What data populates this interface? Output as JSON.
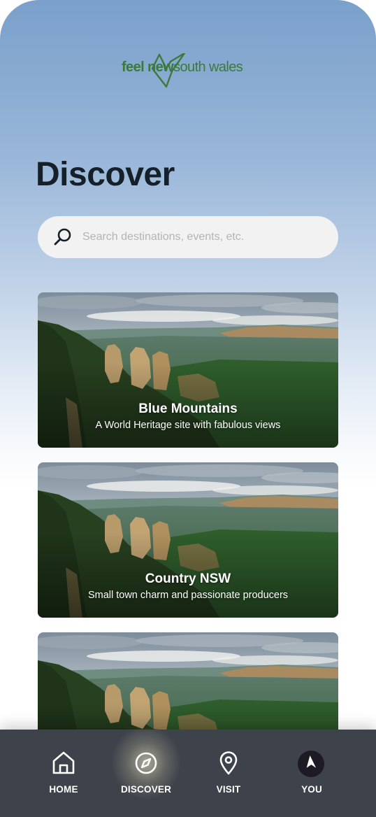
{
  "brand": {
    "logo_bold": "feel new",
    "logo_regular": "south wales",
    "logo_color": "#3b7a3a"
  },
  "page": {
    "title": "Discover"
  },
  "search": {
    "placeholder": "Search destinations, events, etc.",
    "value": "",
    "icon": "search-icon"
  },
  "cards": [
    {
      "title": "Blue Mountains",
      "subtitle": "A World Heritage site with fabulous views"
    },
    {
      "title": "Country NSW",
      "subtitle": "Small town charm and passionate producers"
    },
    {
      "title": "",
      "subtitle": ""
    }
  ],
  "tabbar": {
    "background": "#3e424b",
    "active_tab": "DISCOVER",
    "tabs": [
      {
        "label": "HOME",
        "icon": "home-icon"
      },
      {
        "label": "DISCOVER",
        "icon": "compass-icon"
      },
      {
        "label": "VISIT",
        "icon": "location-pin-icon"
      },
      {
        "label": "YOU",
        "icon": "navigation-arrow-icon"
      }
    ]
  }
}
